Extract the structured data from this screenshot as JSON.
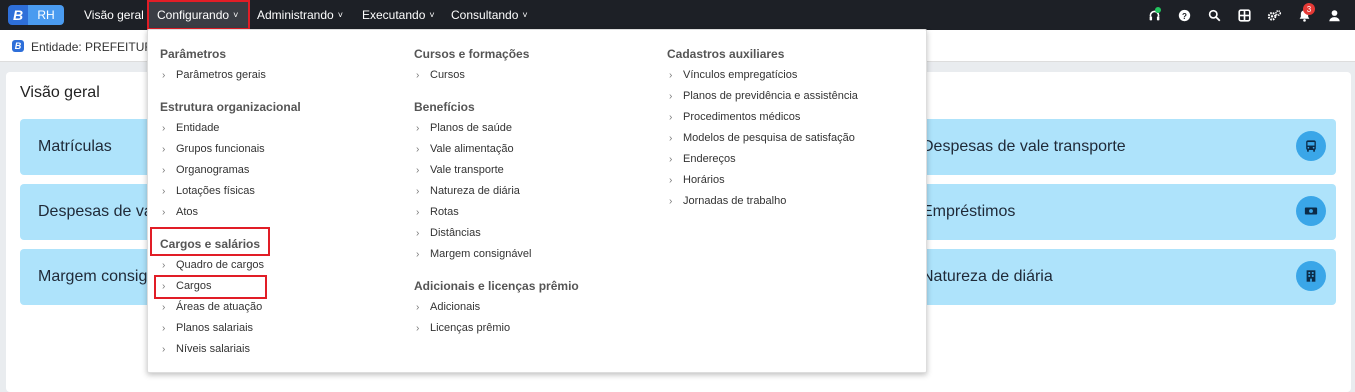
{
  "topbar": {
    "logo_rh": "RH",
    "nav": [
      "Visão geral",
      "Configurando",
      "Administrando",
      "Executando",
      "Consultando"
    ],
    "notifications_count": "3",
    "icons": [
      "headset-icon",
      "help-icon",
      "search-icon",
      "apps-icon",
      "settings-icon",
      "bell-icon",
      "user-icon"
    ]
  },
  "entity": {
    "text": "Entidade: PREFEITURA D"
  },
  "overview": {
    "title": "Visão geral",
    "cards_left": [
      "Matrículas",
      "Despesas de val",
      "Margem consig"
    ],
    "cards_right": [
      "Despesas de vale transporte",
      "Empréstimos",
      "Natureza de diária"
    ]
  },
  "menu": {
    "col1": {
      "s1": "Parâmetros",
      "s1_items": [
        "Parâmetros gerais"
      ],
      "s2": "Estrutura organizacional",
      "s2_items": [
        "Entidade",
        "Grupos funcionais",
        "Organogramas",
        "Lotações físicas",
        "Atos"
      ],
      "s3": "Cargos e salários",
      "s3_items": [
        "Quadro de cargos",
        "Cargos",
        "Áreas de atuação",
        "Planos salariais",
        "Níveis salariais"
      ]
    },
    "col2": {
      "s1": "Cursos e formações",
      "s1_items": [
        "Cursos"
      ],
      "s2": "Benefícios",
      "s2_items": [
        "Planos de saúde",
        "Vale alimentação",
        "Vale transporte",
        "Natureza de diária",
        "Rotas",
        "Distâncias",
        "Margem consignável"
      ],
      "s3": "Adicionais e licenças prêmio",
      "s3_items": [
        "Adicionais",
        "Licenças prêmio"
      ]
    },
    "col3": {
      "s1": "Cadastros auxiliares",
      "s1_items": [
        "Vínculos empregatícios",
        "Planos de previdência e assistência",
        "Procedimentos médicos",
        "Modelos de pesquisa de satisfação",
        "Endereços",
        "Horários",
        "Jornadas de trabalho"
      ]
    }
  },
  "colors": {
    "topbar": "#1d2026",
    "card": "#aee3fb",
    "card_icon": "#3aa6e8",
    "highlight": "#e11d26"
  }
}
